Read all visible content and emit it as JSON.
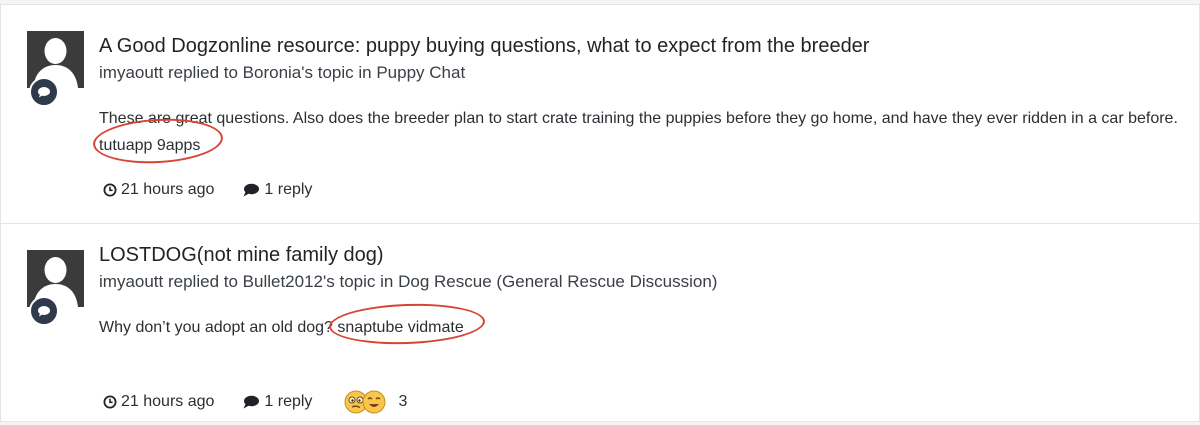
{
  "entries": [
    {
      "title": "A Good Dogzonline resource: puppy buying questions, what to expect from the breeder",
      "author": "imyaoutt",
      "action": "replied to",
      "topic_owner": "Boronia's",
      "topic_word": "topic in",
      "forum": "Puppy Chat",
      "snippet_text": "These are great questions. Also does the breeder plan to start crate training the puppies before they go home, and have they ever ridden in a car before.",
      "snippet_circled": "tutuapp 9apps",
      "time": "21 hours ago",
      "replies": "1 reply"
    },
    {
      "title": "LOSTDOG(not mine family dog)",
      "author": "imyaoutt",
      "action": "replied to",
      "topic_owner": "Bullet2012's",
      "topic_word": "topic in",
      "forum": "Dog Rescue (General Rescue Discussion)",
      "snippet_text": "Why don’t you adopt an old dog?",
      "snippet_circled": "snaptube vidmate",
      "time": "21 hours ago",
      "replies": "1 reply",
      "reaction_count": "3"
    }
  ],
  "colors": {
    "annotation_ring": "#d64532",
    "badge": "#2f3a4d",
    "avatar_bg": "#3b3b3b"
  },
  "icons": {
    "avatar": "default-user-silhouette-icon",
    "badge": "speech-bubble-icon",
    "time": "clock-icon",
    "replies": "comment-icon",
    "reactions": [
      "confused-emoji-icon",
      "laughing-emoji-icon"
    ]
  }
}
